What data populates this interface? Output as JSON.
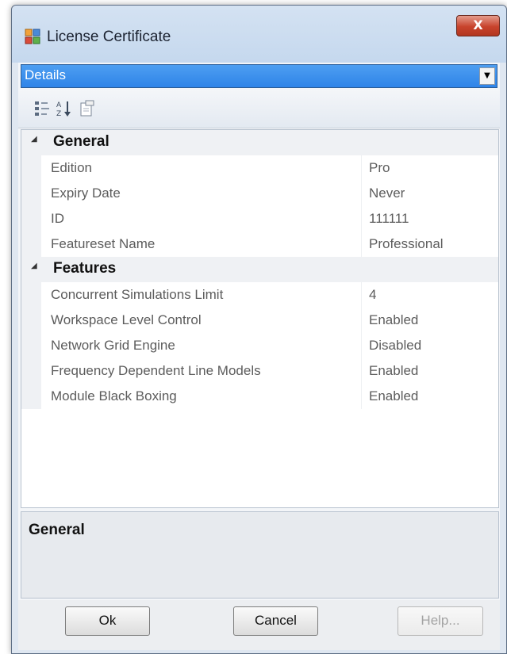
{
  "window": {
    "title": "License Certificate",
    "close_label": "X"
  },
  "selector": {
    "value": "Details"
  },
  "categories": [
    {
      "name": "General",
      "properties": [
        {
          "name": "Edition",
          "value": "Pro"
        },
        {
          "name": "Expiry Date",
          "value": "Never"
        },
        {
          "name": "ID",
          "value": "111111"
        },
        {
          "name": "Featureset Name",
          "value": "Professional"
        }
      ]
    },
    {
      "name": "Features",
      "properties": [
        {
          "name": "Concurrent Simulations Limit",
          "value": "4"
        },
        {
          "name": "Workspace Level Control",
          "value": "Enabled"
        },
        {
          "name": "Network Grid Engine",
          "value": "Disabled"
        },
        {
          "name": "Frequency Dependent Line Models",
          "value": "Enabled"
        },
        {
          "name": "Module Black Boxing",
          "value": "Enabled"
        }
      ]
    }
  ],
  "description": {
    "title": "General"
  },
  "buttons": {
    "ok": "Ok",
    "cancel": "Cancel",
    "help": "Help..."
  },
  "icons": {
    "app": "license-app-icon",
    "categorized": "categorized-view-icon",
    "sort": "sort-alphabetical-icon",
    "property_pages": "property-pages-icon",
    "collapse": "collapse-triangle-icon"
  },
  "colors": {
    "selection": "#2f84e8",
    "close": "#c8432c"
  }
}
